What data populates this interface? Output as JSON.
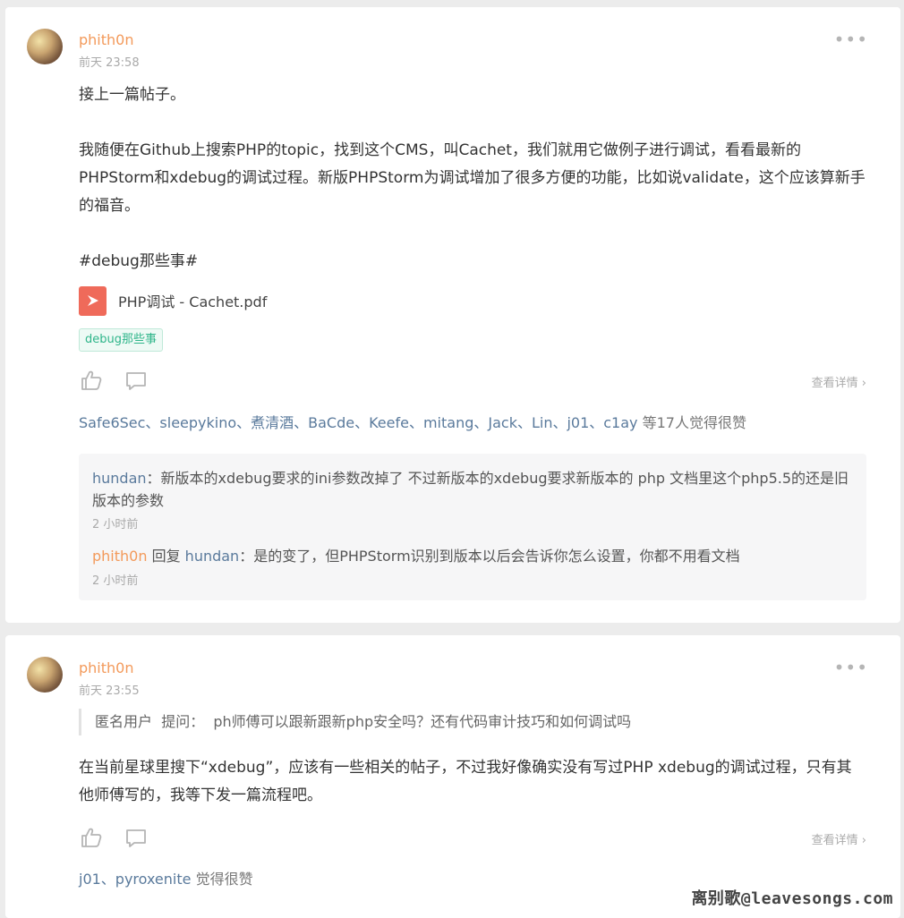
{
  "posts": [
    {
      "author": "phith0n",
      "time": "前天 23:58",
      "more": "•••",
      "paragraphs": [
        "接上一篇帖子。",
        "我随便在Github上搜索PHP的topic，找到这个CMS，叫Cachet，我们就用它做例子进行调试，看看最新的PHPStorm和xdebug的调试过程。新版PHPStorm为调试增加了很多方便的功能，比如说validate，这个应该算新手的福音。",
        "#debug那些事#"
      ],
      "attachment": "PHP调试 - Cachet.pdf",
      "tag": "debug那些事",
      "detail_link": "查看详情",
      "likes": {
        "names": "Safe6Sec、sleepykino、煮清酒、BaCde、Keefe、mitang、Jack、Lin、j01、c1ay",
        "suffix": " 等17人觉得很赞"
      },
      "comments": [
        {
          "name": "hundan",
          "sep": "：",
          "text": "新版本的xdebug要求的ini参数改掉了 不过新版本的xdebug要求新版本的 php 文档里这个php5.5的还是旧版本的参数",
          "time": "2 小时前"
        },
        {
          "name": "phith0n",
          "reply_word": " 回复 ",
          "reply_to": "hundan",
          "sep": "：",
          "text": "是的变了，但PHPStorm识别到版本以后会告诉你怎么设置，你都不用看文档",
          "time": "2 小时前"
        }
      ]
    },
    {
      "author": "phith0n",
      "time": "前天 23:55",
      "more": "•••",
      "question": {
        "asker": "匿名用户",
        "ask_word": "提问：",
        "text": "ph师傅可以跟新跟新php安全吗？还有代码审计技巧和如何调试吗"
      },
      "paragraphs": [
        "在当前星球里搜下“xdebug”，应该有一些相关的帖子，不过我好像确实没有写过PHP xdebug的调试过程，只有其他师傅写的，我等下发一篇流程吧。"
      ],
      "detail_link": "查看详情",
      "likes": {
        "names": "j01、pyroxenite",
        "suffix": " 觉得很赞"
      }
    }
  ],
  "site_watermark": "离别歌@leavesongs.com",
  "icons": [
    "avatar",
    "more-icon",
    "pdf-icon",
    "like-icon",
    "comment-icon",
    "chevron-right-icon"
  ],
  "colors": {
    "author": "#f39a5b",
    "link_names": "#5a7a9c",
    "tag": "#2fb58a",
    "pdf": "#ef6a5a"
  }
}
